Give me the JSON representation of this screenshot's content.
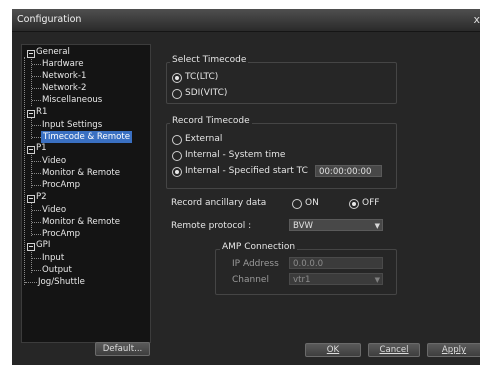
{
  "window": {
    "title": "Configuration",
    "close_glyph": "x"
  },
  "tree": {
    "general": "General",
    "hardware": "Hardware",
    "network1": "Network-1",
    "network2": "Network-2",
    "misc": "Miscellaneous",
    "r1": "R1",
    "input_settings": "Input Settings",
    "timecode_remote": "Timecode & Remote",
    "p1": "P1",
    "p1_video": "Video",
    "p1_monitor": "Monitor & Remote",
    "p1_procamp": "ProcAmp",
    "p2": "P2",
    "p2_video": "Video",
    "p2_monitor": "Monitor & Remote",
    "p2_procamp": "ProcAmp",
    "gpi": "GPI",
    "gpi_input": "Input",
    "gpi_output": "Output",
    "jog": "Jog/Shuttle",
    "selected": "timecode_remote"
  },
  "select_timecode": {
    "title": "Select Timecode",
    "tc_ltc": "TC(LTC)",
    "sdi_vitc": "SDI(VITC)",
    "selected": "tc_ltc"
  },
  "record_timecode": {
    "title": "Record Timecode",
    "external": "External",
    "internal_system": "Internal - System time",
    "internal_specified": "Internal - Specified start TC",
    "start_tc": "00:00:00:00",
    "selected": "internal_specified"
  },
  "ancillary": {
    "label": "Record ancillary data",
    "on": "ON",
    "off": "OFF",
    "selected": "off"
  },
  "remote_protocol": {
    "label": "Remote protocol :",
    "value": "BVW"
  },
  "amp": {
    "title": "AMP Connection",
    "ip_label": "IP Address",
    "ip_value": "0.0.0.0",
    "channel_label": "Channel",
    "channel_value": "vtr1"
  },
  "buttons": {
    "default": "Default...",
    "ok": "OK",
    "cancel": "Cancel",
    "apply": "Apply"
  },
  "icons": {
    "dropdown": "chevron-down-icon",
    "close": "close-icon",
    "collapse": "minus-box-icon"
  }
}
